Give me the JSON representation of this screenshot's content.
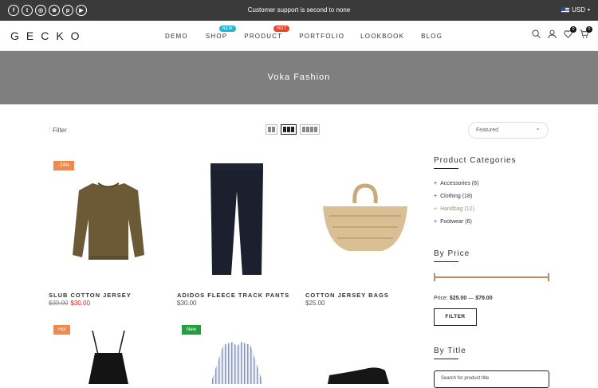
{
  "topbar": {
    "message": "Customer support is second to none",
    "currency": "USD",
    "social": [
      "facebook-icon",
      "twitter-icon",
      "instagram-icon",
      "dribbble-icon",
      "pinterest-icon",
      "youtube-icon"
    ]
  },
  "header": {
    "logo": "GECKO",
    "nav": [
      {
        "label": "DEMO"
      },
      {
        "label": "SHOP",
        "badge": "NEW",
        "badge_color": "#23b5d3"
      },
      {
        "label": "PRODUCT",
        "badge": "HOT",
        "badge_color": "#e8452c"
      },
      {
        "label": "PORTFOLIO"
      },
      {
        "label": "LOOKBOOK"
      },
      {
        "label": "BLOG"
      }
    ],
    "wishlist_count": "0",
    "cart_count": "0"
  },
  "banner": {
    "title": "Voka Fashion"
  },
  "toolbar": {
    "filter_label": "Filter",
    "sort_value": "Featured"
  },
  "products": [
    {
      "name": "SLUB COTTON JERSEY",
      "old_price": "$39.00",
      "price": "$30.00",
      "tag": "-24%",
      "tag_color": "#f08a4b"
    },
    {
      "name": "ADIDOS FLEECE TRACK PANTS",
      "price": "$30.00"
    },
    {
      "name": "COTTON JERSEY BAGS",
      "price": "$25.00"
    },
    {
      "tag": "Hot",
      "tag_color": "#f08a4b"
    },
    {
      "tag": "New",
      "tag_color": "#22a03c"
    },
    {}
  ],
  "sidebar": {
    "categories_title": "Product Categories",
    "categories": [
      "Accessories (6)",
      "Clothing (18)",
      "Handbag (12)",
      "Footwear (6)"
    ],
    "active_category_color": "#b58d6a",
    "price_title": "By Price",
    "price_prefix": "Price:",
    "price_min": "$25.00",
    "price_sep": "—",
    "price_max": "$79.00",
    "filter_button": "FILTER",
    "title_title": "By Title",
    "search_placeholder": "Search for product title"
  }
}
